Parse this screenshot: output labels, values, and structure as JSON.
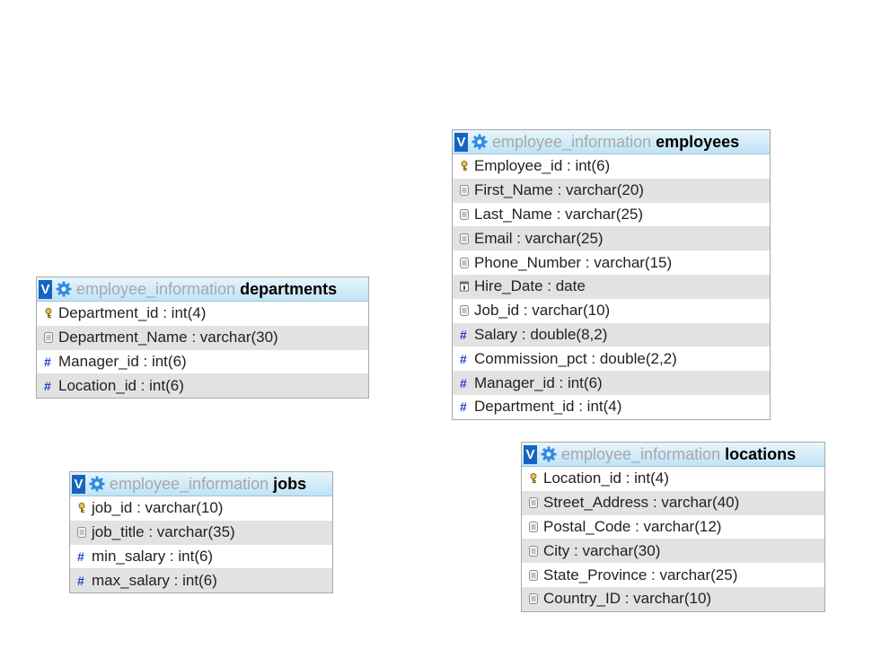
{
  "tables": [
    {
      "db": "employee_information",
      "name": "employees",
      "columns": [
        {
          "text": "Employee_id : int(6)",
          "icon": "key-icon"
        },
        {
          "text": "First_Name : varchar(20)",
          "icon": "text-column-icon"
        },
        {
          "text": "Last_Name : varchar(25)",
          "icon": "text-column-icon"
        },
        {
          "text": "Email : varchar(25)",
          "icon": "text-column-icon"
        },
        {
          "text": "Phone_Number : varchar(15)",
          "icon": "text-column-icon"
        },
        {
          "text": "Hire_Date : date",
          "icon": "date-column-icon"
        },
        {
          "text": "Job_id : varchar(10)",
          "icon": "text-column-icon"
        },
        {
          "text": "Salary : double(8,2)",
          "icon": "numeric-column-icon"
        },
        {
          "text": "Commission_pct : double(2,2)",
          "icon": "numeric-column-icon"
        },
        {
          "text": "Manager_id : int(6)",
          "icon": "numeric-column-icon"
        },
        {
          "text": "Department_id : int(4)",
          "icon": "numeric-column-icon"
        }
      ]
    },
    {
      "db": "employee_information",
      "name": "departments",
      "columns": [
        {
          "text": "Department_id : int(4)",
          "icon": "key-icon"
        },
        {
          "text": "Department_Name : varchar(30)",
          "icon": "text-column-icon"
        },
        {
          "text": "Manager_id : int(6)",
          "icon": "numeric-column-icon"
        },
        {
          "text": "Location_id : int(6)",
          "icon": "numeric-column-icon"
        }
      ]
    },
    {
      "db": "employee_information",
      "name": "locations",
      "columns": [
        {
          "text": "Location_id : int(4)",
          "icon": "key-icon"
        },
        {
          "text": "Street_Address : varchar(40)",
          "icon": "text-column-icon"
        },
        {
          "text": "Postal_Code : varchar(12)",
          "icon": "text-column-icon"
        },
        {
          "text": "City : varchar(30)",
          "icon": "text-column-icon"
        },
        {
          "text": "State_Province : varchar(25)",
          "icon": "text-column-icon"
        },
        {
          "text": "Country_ID : varchar(10)",
          "icon": "text-column-icon"
        }
      ]
    },
    {
      "db": "employee_information",
      "name": "jobs",
      "columns": [
        {
          "text": "job_id : varchar(10)",
          "icon": "key-icon"
        },
        {
          "text": "job_title : varchar(35)",
          "icon": "text-column-icon"
        },
        {
          "text": "min_salary : int(6)",
          "icon": "numeric-column-icon"
        },
        {
          "text": "max_salary : int(6)",
          "icon": "numeric-column-icon"
        }
      ]
    }
  ],
  "toggle_label": "V"
}
